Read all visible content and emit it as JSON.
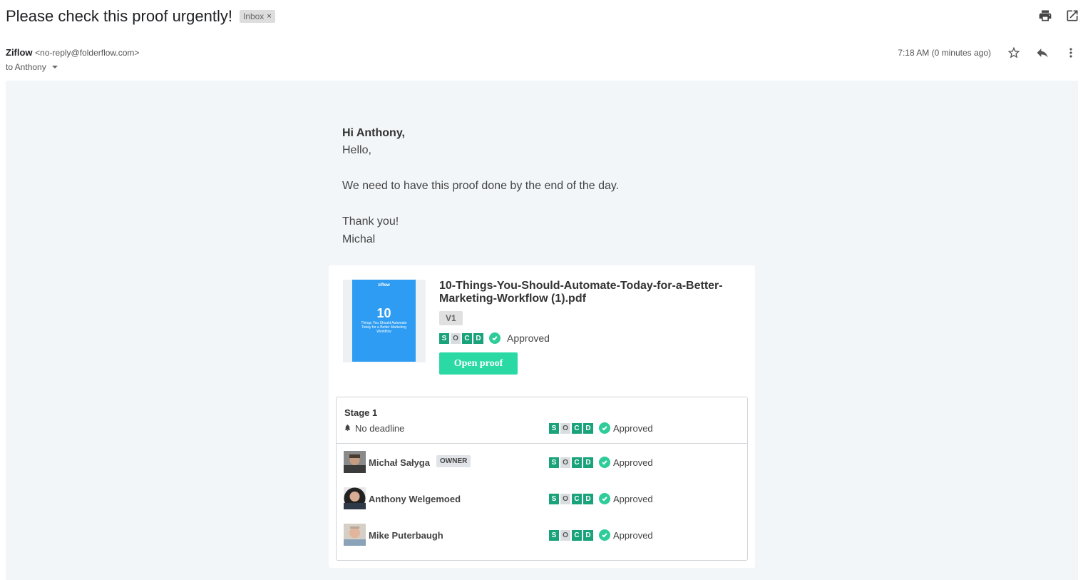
{
  "email": {
    "subject": "Please check this proof urgently!",
    "label": "Inbox",
    "label_remove": "×",
    "sender_name": "Ziflow",
    "sender_email": "<no-reply@folderflow.com>",
    "recipient": "to Anthony",
    "timestamp": "7:18 AM (0 minutes ago)"
  },
  "icons": {
    "print": "print-icon",
    "open_new_window": "open-in-new-window-icon",
    "star": "star-icon",
    "reply": "reply-icon",
    "more": "more-vertical-icon"
  },
  "message": {
    "greeting": "Hi Anthony,",
    "line1": "Hello,",
    "line2": "We need to have this proof done by the end of the day.",
    "line3": "Thank you!",
    "line4": "Michal"
  },
  "proof": {
    "thumbnail": {
      "logo": "ziflow",
      "number": "10",
      "subtitle": "Things You Should Automate Today for a Better Marketing Workflow"
    },
    "filename": "10-Things-You-Should-Automate-Today-for-a-Better-Marketing-Workflow (1).pdf",
    "version": "V1",
    "status_letters": [
      "S",
      "O",
      "C",
      "D"
    ],
    "status": "Approved",
    "open_button": "Open proof"
  },
  "stage": {
    "title": "Stage 1",
    "deadline": "No deadline",
    "status": "Approved",
    "members": [
      {
        "name": "Michał Sałyga",
        "badge": "OWNER",
        "status": "Approved"
      },
      {
        "name": "Anthony Welgemoed",
        "status": "Approved"
      },
      {
        "name": "Mike Puterbaugh",
        "status": "Approved"
      }
    ]
  },
  "colors": {
    "accent": "#2bd9a5",
    "status_on": "#1aa37a",
    "check": "#2ecc99",
    "body_bg": "#f3f6f9",
    "thumbnail_blue": "#2d9cf2"
  }
}
